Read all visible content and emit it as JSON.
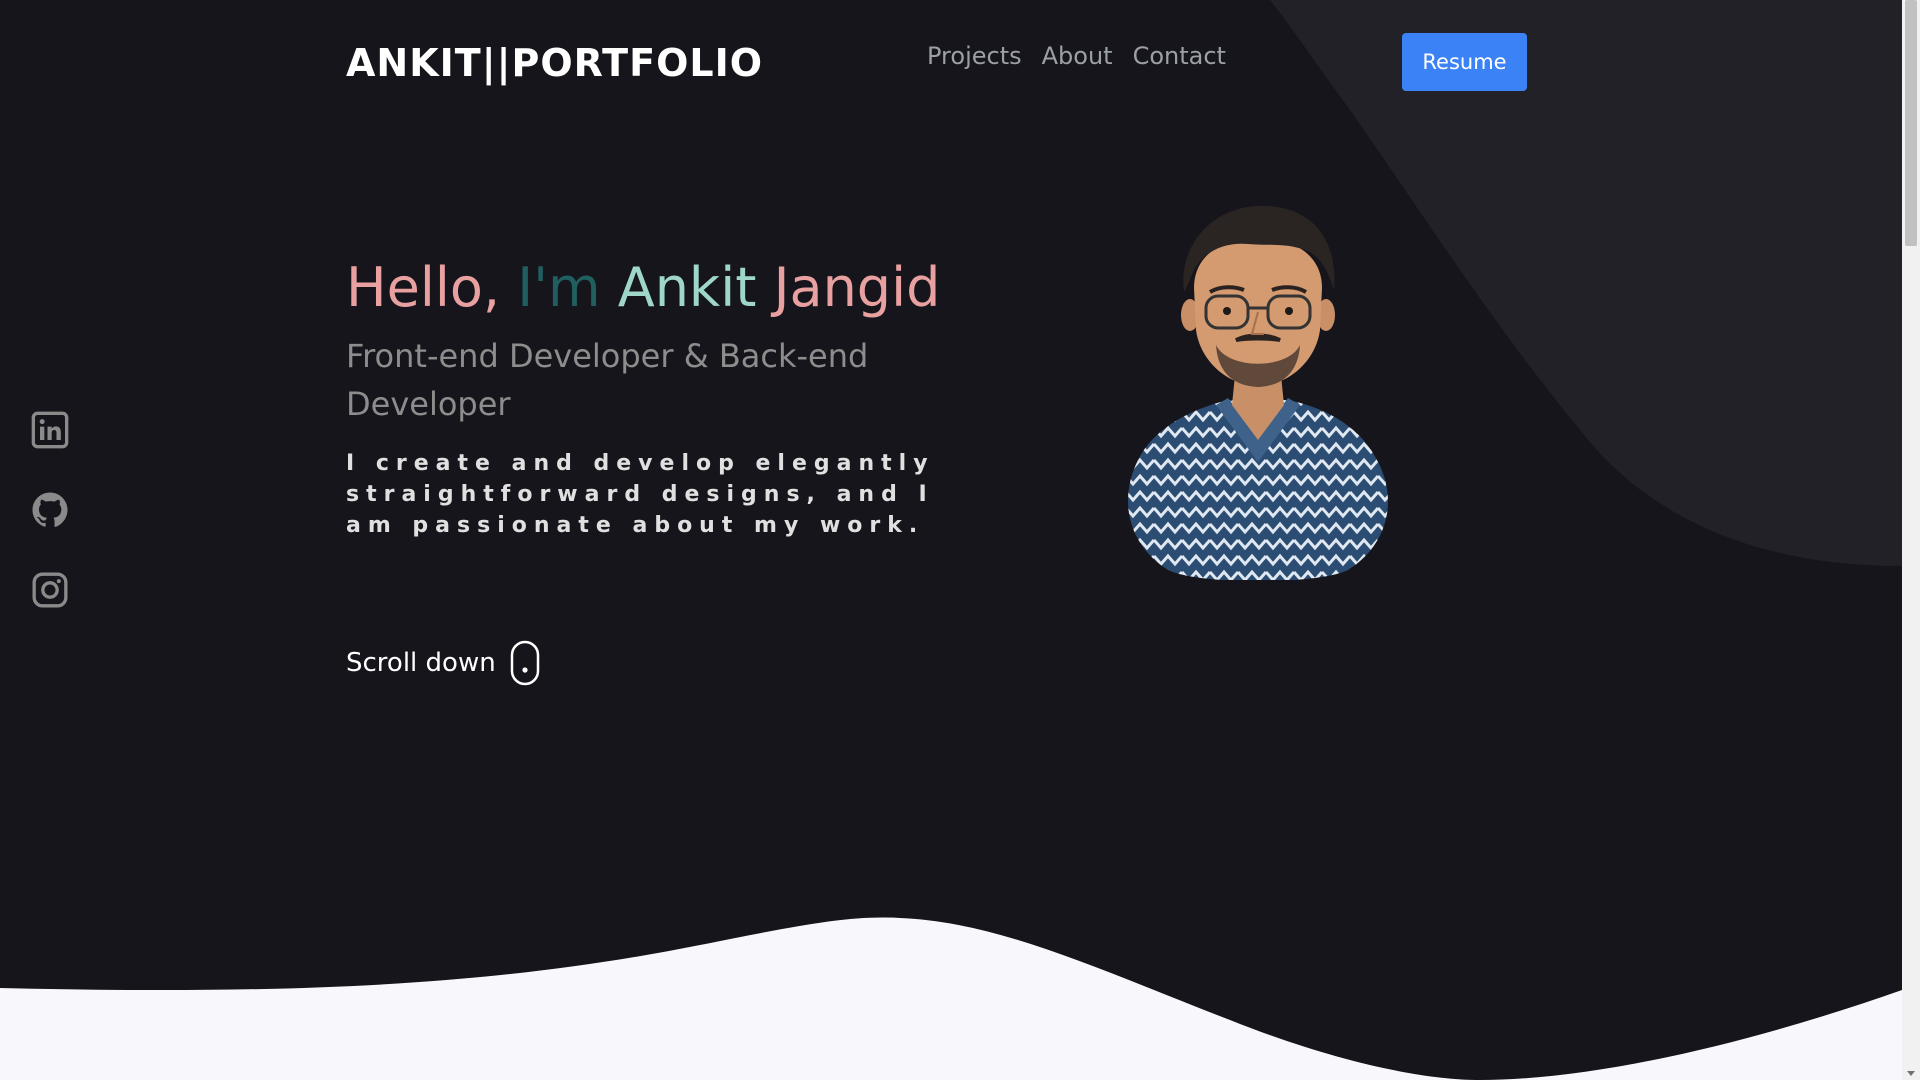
{
  "header": {
    "logo_text": "ANKIT||PORTFOLIO",
    "nav": [
      "Projects",
      "About",
      "Contact"
    ],
    "resume_label": "Resume"
  },
  "social": {
    "icons": [
      "linkedin-icon",
      "github-icon",
      "instagram-icon"
    ]
  },
  "hero": {
    "hello": "Hello,",
    "im": "I'm",
    "first_name": "Ankit",
    "last_name": "Jangid",
    "role": "Front-end Developer & Back-end Developer",
    "tagline": "I create and develop elegantly straightforward designs, and I am passionate about my work.",
    "scroll_label": "Scroll down"
  },
  "colors": {
    "background": "#16151b",
    "accent_blue": "#3b82f6",
    "pink": "#e8a0a0",
    "teal": "#9fd6cc",
    "dark_teal": "#1f5f5f",
    "light_section": "#f8f7fc"
  }
}
